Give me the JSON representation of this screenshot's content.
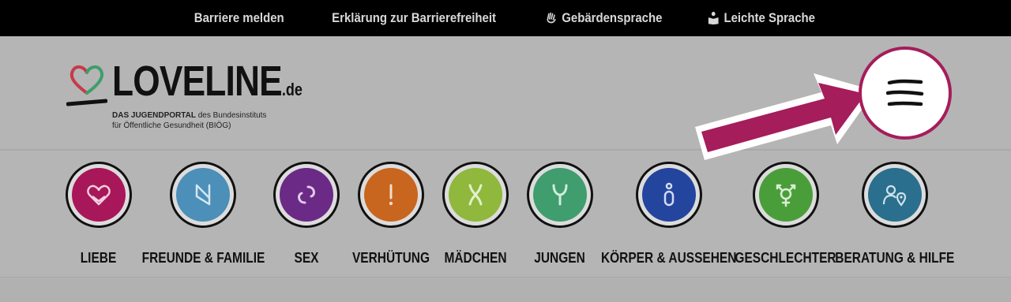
{
  "topbar": {
    "links": [
      {
        "label": "Barriere melden",
        "icon": ""
      },
      {
        "label": "Erklärung zur Barrierefreiheit",
        "icon": ""
      },
      {
        "label": "Gebärdensprache",
        "icon": "sign-language-icon"
      },
      {
        "label": "Leichte Sprache",
        "icon": "easy-language-icon"
      }
    ]
  },
  "logo": {
    "word": "LOVELINE",
    "tld": ".de",
    "sub_bold": "DAS JUGENDPORTAL",
    "sub_line1_rest": " des Bundesinstituts",
    "sub_line2": "für Öffentliche Gesundheit (BIÖG)"
  },
  "menu": {
    "icon": "hamburger-menu-icon",
    "highlight_color": "#a51d5b"
  },
  "categories": [
    {
      "label": "LIEBE",
      "color": "#a8175a",
      "icon": "heart-icon"
    },
    {
      "label": "FREUNDE & FAMILIE",
      "color": "#4c8fb8",
      "icon": "friends-icon"
    },
    {
      "label": "SEX",
      "color": "#6a2a86",
      "icon": "sex-icon"
    },
    {
      "label": "VERHÜTUNG",
      "color": "#c8651e",
      "icon": "exclamation-icon"
    },
    {
      "label": "MÄDCHEN",
      "color": "#8fb83c",
      "icon": "x-chromosome-icon"
    },
    {
      "label": "JUNGEN",
      "color": "#3f9d6e",
      "icon": "y-chromosome-icon"
    },
    {
      "label": "KÖRPER & AUSSEHEN",
      "color": "#23459e",
      "icon": "body-icon"
    },
    {
      "label": "GESCHLECHTER",
      "color": "#4a9e3a",
      "icon": "gender-symbol-icon"
    },
    {
      "label": "BERATUNG & HILFE",
      "color": "#2a6f8d",
      "icon": "counseling-icon"
    }
  ]
}
